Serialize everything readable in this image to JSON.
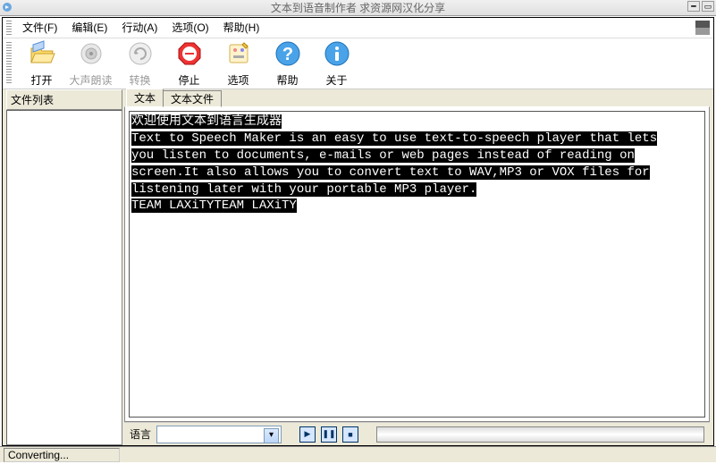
{
  "window": {
    "title": "文本到语音制作者 求资源网汉化分享"
  },
  "menu": {
    "file": "文件(F)",
    "edit": "编辑(E)",
    "action": "行动(A)",
    "options": "选项(O)",
    "help": "帮助(H)"
  },
  "toolbar": {
    "open": "打开",
    "read": "大声朗读",
    "convert": "转换",
    "stop": "停止",
    "options": "选项",
    "help": "帮助",
    "about": "关于"
  },
  "sidebar": {
    "title": "文件列表"
  },
  "tabs": {
    "text": "文本",
    "textfile": "文本文件"
  },
  "editor": {
    "line1": "欢迎使用文本到语言生成器",
    "line2": "Text to Speech Maker is an easy to use text-to-speech player that lets",
    "line3": "you listen to documents, e-mails or web pages instead of reading on",
    "line4": "screen.It also allows you to convert text to WAV,MP3 or VOX files for",
    "line5": "listening later with your portable MP3 player.",
    "line6": "TEAM LAXiTYTEAM LAXiTY"
  },
  "bottom": {
    "language_label": "语言",
    "language_value": ""
  },
  "status": {
    "text": "Converting..."
  }
}
